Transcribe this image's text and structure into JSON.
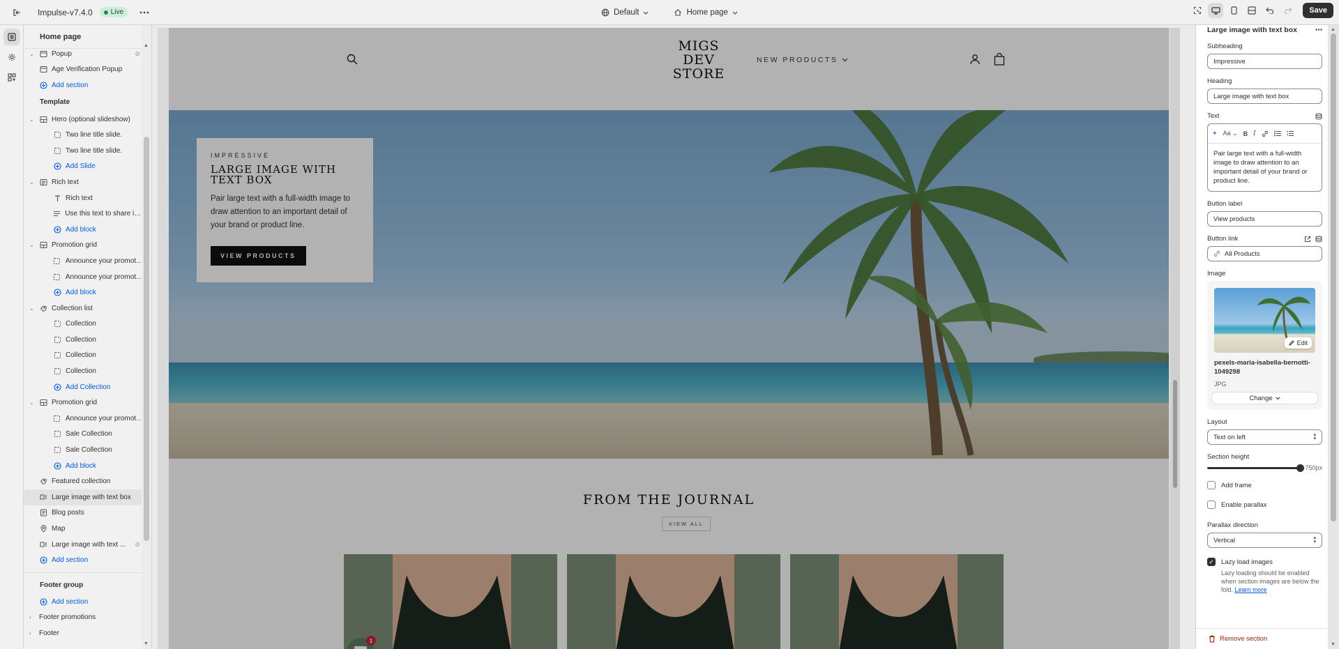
{
  "topbar": {
    "theme_name": "Impulse-v7.4.0",
    "live_badge": "Live",
    "theme_dropdown": "Default",
    "page_dropdown": "Home page",
    "save_label": "Save"
  },
  "sidebar": {
    "title": "Home page",
    "rows": [
      {
        "type": "section",
        "label": "Popup",
        "icon": "popup-icon",
        "chevron": true,
        "cut": true
      },
      {
        "type": "section",
        "label": "Age Verification Popup",
        "icon": "popup-icon"
      },
      {
        "type": "add",
        "label": "Add section",
        "level": 1
      },
      {
        "type": "group",
        "label": "Template"
      },
      {
        "type": "section",
        "label": "Hero (optional slideshow)",
        "icon": "slideshow-icon",
        "chevron": true
      },
      {
        "type": "block",
        "label": "Two line title slide."
      },
      {
        "type": "block",
        "label": "Two line title slide."
      },
      {
        "type": "add",
        "label": "Add Slide",
        "level": 2
      },
      {
        "type": "section",
        "label": "Rich text",
        "icon": "text-block-icon",
        "chevron": true
      },
      {
        "type": "block",
        "label": "Rich text",
        "icon": "heading-icon"
      },
      {
        "type": "block",
        "label": "Use this text to share info...",
        "icon": "paragraph-icon"
      },
      {
        "type": "add",
        "label": "Add block",
        "level": 2
      },
      {
        "type": "section",
        "label": "Promotion grid",
        "icon": "slideshow-icon",
        "chevron": true
      },
      {
        "type": "block",
        "label": "Announce your promotion"
      },
      {
        "type": "block",
        "label": "Announce your promotion"
      },
      {
        "type": "add",
        "label": "Add block",
        "level": 2
      },
      {
        "type": "section",
        "label": "Collection list",
        "icon": "collection-icon",
        "chevron": true
      },
      {
        "type": "block",
        "label": "Collection"
      },
      {
        "type": "block",
        "label": "Collection"
      },
      {
        "type": "block",
        "label": "Collection"
      },
      {
        "type": "block",
        "label": "Collection"
      },
      {
        "type": "add",
        "label": "Add Collection",
        "level": 2
      },
      {
        "type": "section",
        "label": "Promotion grid",
        "icon": "slideshow-icon",
        "chevron": true
      },
      {
        "type": "block",
        "label": "Announce your promotion"
      },
      {
        "type": "block",
        "label": "Sale Collection"
      },
      {
        "type": "block",
        "label": "Sale Collection"
      },
      {
        "type": "add",
        "label": "Add block",
        "level": 2
      },
      {
        "type": "section",
        "label": "Featured collection",
        "icon": "collection-icon"
      },
      {
        "type": "section",
        "label": "Large image with text box",
        "icon": "image-text-icon",
        "selected": true
      },
      {
        "type": "section",
        "label": "Blog posts",
        "icon": "blog-icon"
      },
      {
        "type": "section",
        "label": "Map",
        "icon": "map-pin-icon"
      },
      {
        "type": "section",
        "label": "Large image with text ...",
        "icon": "image-text-icon",
        "hidden": true
      },
      {
        "type": "add",
        "label": "Add section",
        "level": 1
      },
      {
        "type": "divider"
      },
      {
        "type": "group",
        "label": "Footer group"
      },
      {
        "type": "add",
        "label": "Add section",
        "level": 1
      },
      {
        "type": "section",
        "label": "Footer promotions",
        "icon": "",
        "chevron": true,
        "right_chev": true
      },
      {
        "type": "section",
        "label": "Footer",
        "icon": "",
        "chevron": true,
        "right_chev": true
      }
    ]
  },
  "preview": {
    "logo_lines": [
      "MIGS",
      "DEV",
      "STORE"
    ],
    "nav_link": "NEW PRODUCTS",
    "hero": {
      "subheading": "IMPRESSIVE",
      "heading": "LARGE IMAGE WITH TEXT BOX",
      "text": "Pair large text with a full-width image to draw attention to an important detail of your brand or product line.",
      "button": "VIEW PRODUCTS"
    },
    "journal_title": "FROM THE JOURNAL",
    "view_all": "VIEW ALL",
    "chat_count": "1"
  },
  "settings": {
    "title": "Large image with text box",
    "subheading_label": "Subheading",
    "subheading_value": "Impressive",
    "heading_label": "Heading",
    "heading_value": "Large image with text box",
    "text_label": "Text",
    "text_value": "Pair large text with a full-width image to draw attention to an important detail of your brand or product line.",
    "button_label_label": "Button label",
    "button_label_value": "View products",
    "button_link_label": "Button link",
    "button_link_value": "All Products",
    "image_label": "Image",
    "image_edit": "Edit",
    "image_name": "pexels-maria-isabella-bernotti-1049298",
    "image_type": "JPG",
    "change_label": "Change",
    "layout_label": "Layout",
    "layout_value": "Text on left",
    "section_height_label": "Section height",
    "section_height_value": "750px",
    "section_height_fraction": 1.0,
    "add_frame_label": "Add frame",
    "add_frame_checked": false,
    "enable_parallax_label": "Enable parallax",
    "enable_parallax_checked": false,
    "parallax_direction_label": "Parallax direction",
    "parallax_direction_value": "Vertical",
    "lazy_load_label": "Lazy load images",
    "lazy_load_checked": true,
    "lazy_help": "Lazy loading should be enabled when section images are below the fold.",
    "learn_more": "Learn more",
    "remove_section": "Remove section"
  }
}
